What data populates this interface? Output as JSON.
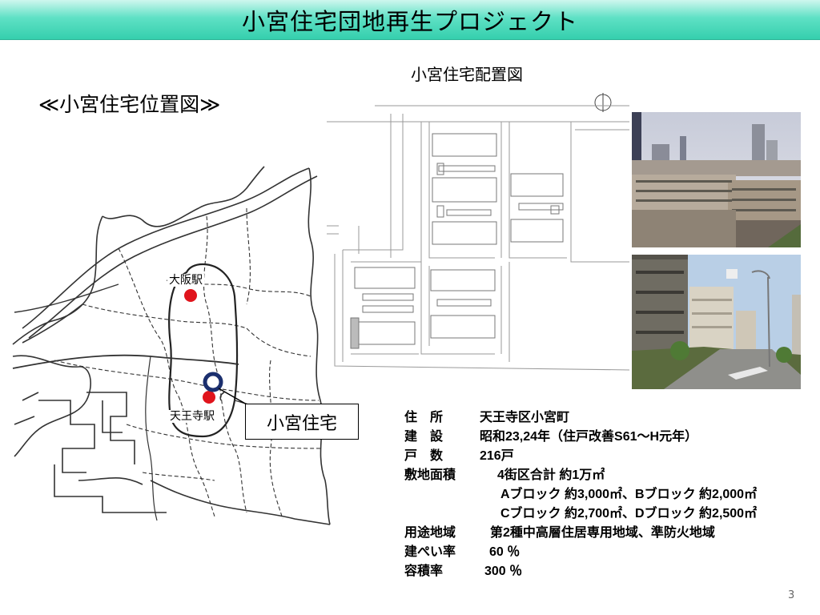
{
  "slide": {
    "title": "小宮住宅団地再生プロジェクト",
    "page_number": "3"
  },
  "location_map": {
    "heading": "≪小宮住宅位置図≫",
    "station_osaka": "大阪駅",
    "station_tennoji": "天王寺駅",
    "callout": "小宮住宅"
  },
  "site_plan": {
    "heading": "小宮住宅配置図"
  },
  "info": {
    "rows": [
      {
        "label": "住　所",
        "value": "天王寺区小宮町"
      },
      {
        "label": "建　設",
        "value": "昭和23,24年（住戸改善S61～H元年）"
      },
      {
        "label": "戸　数",
        "value": "216戸"
      },
      {
        "label": "敷地面積",
        "value": "4街区合計 約1万㎡"
      },
      {
        "label": "",
        "value": "Aブロック 約3,000㎡、Bブロック 約2,000㎡"
      },
      {
        "label": "",
        "value": "Cブロック 約2,700㎡、Dブロック 約2,500㎡"
      },
      {
        "label": "用途地域",
        "value": "第2種中高層住居専用地域、準防火地域"
      },
      {
        "label": "建ぺい率",
        "value": "60 ％"
      },
      {
        "label": "容積率",
        "value": "300 ％"
      }
    ]
  },
  "colors": {
    "title_bar": "#35cfad",
    "station_marker": "#e0141c",
    "site_marker": "#1b2f6e"
  }
}
